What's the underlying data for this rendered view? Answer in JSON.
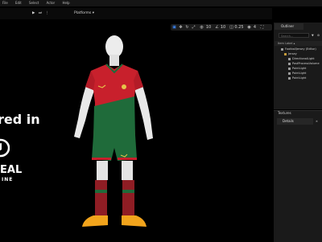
{
  "menu": [
    "File",
    "Edit",
    "Select",
    "Actor",
    "Help"
  ],
  "toolbar": {
    "platforms_label": "Platforms ▾"
  },
  "viewport": {
    "numbers": [
      "10",
      "10",
      "0.25",
      "4"
    ]
  },
  "outliner": {
    "tab_label": "Outliner",
    "search_placeholder": "Search...",
    "column_item_label": "Item Label ▴",
    "items": [
      "FootballJersey (Editor)",
      "Jersey",
      "DirectionalLight",
      "PostProcessVolume",
      "PointLight",
      "PointLight",
      "PointLight"
    ]
  },
  "details": {
    "section_label": "Textures",
    "tab_label": "Details"
  },
  "overlay": {
    "title_fragment": "red in",
    "logo_word": "EAL",
    "logo_sub": "INE"
  },
  "colors": {
    "shirt_red": "#c8202c",
    "shirt_green": "#1f6b3a",
    "boot_orange": "#f2a41c",
    "mannequin": "#e9e9e9"
  }
}
